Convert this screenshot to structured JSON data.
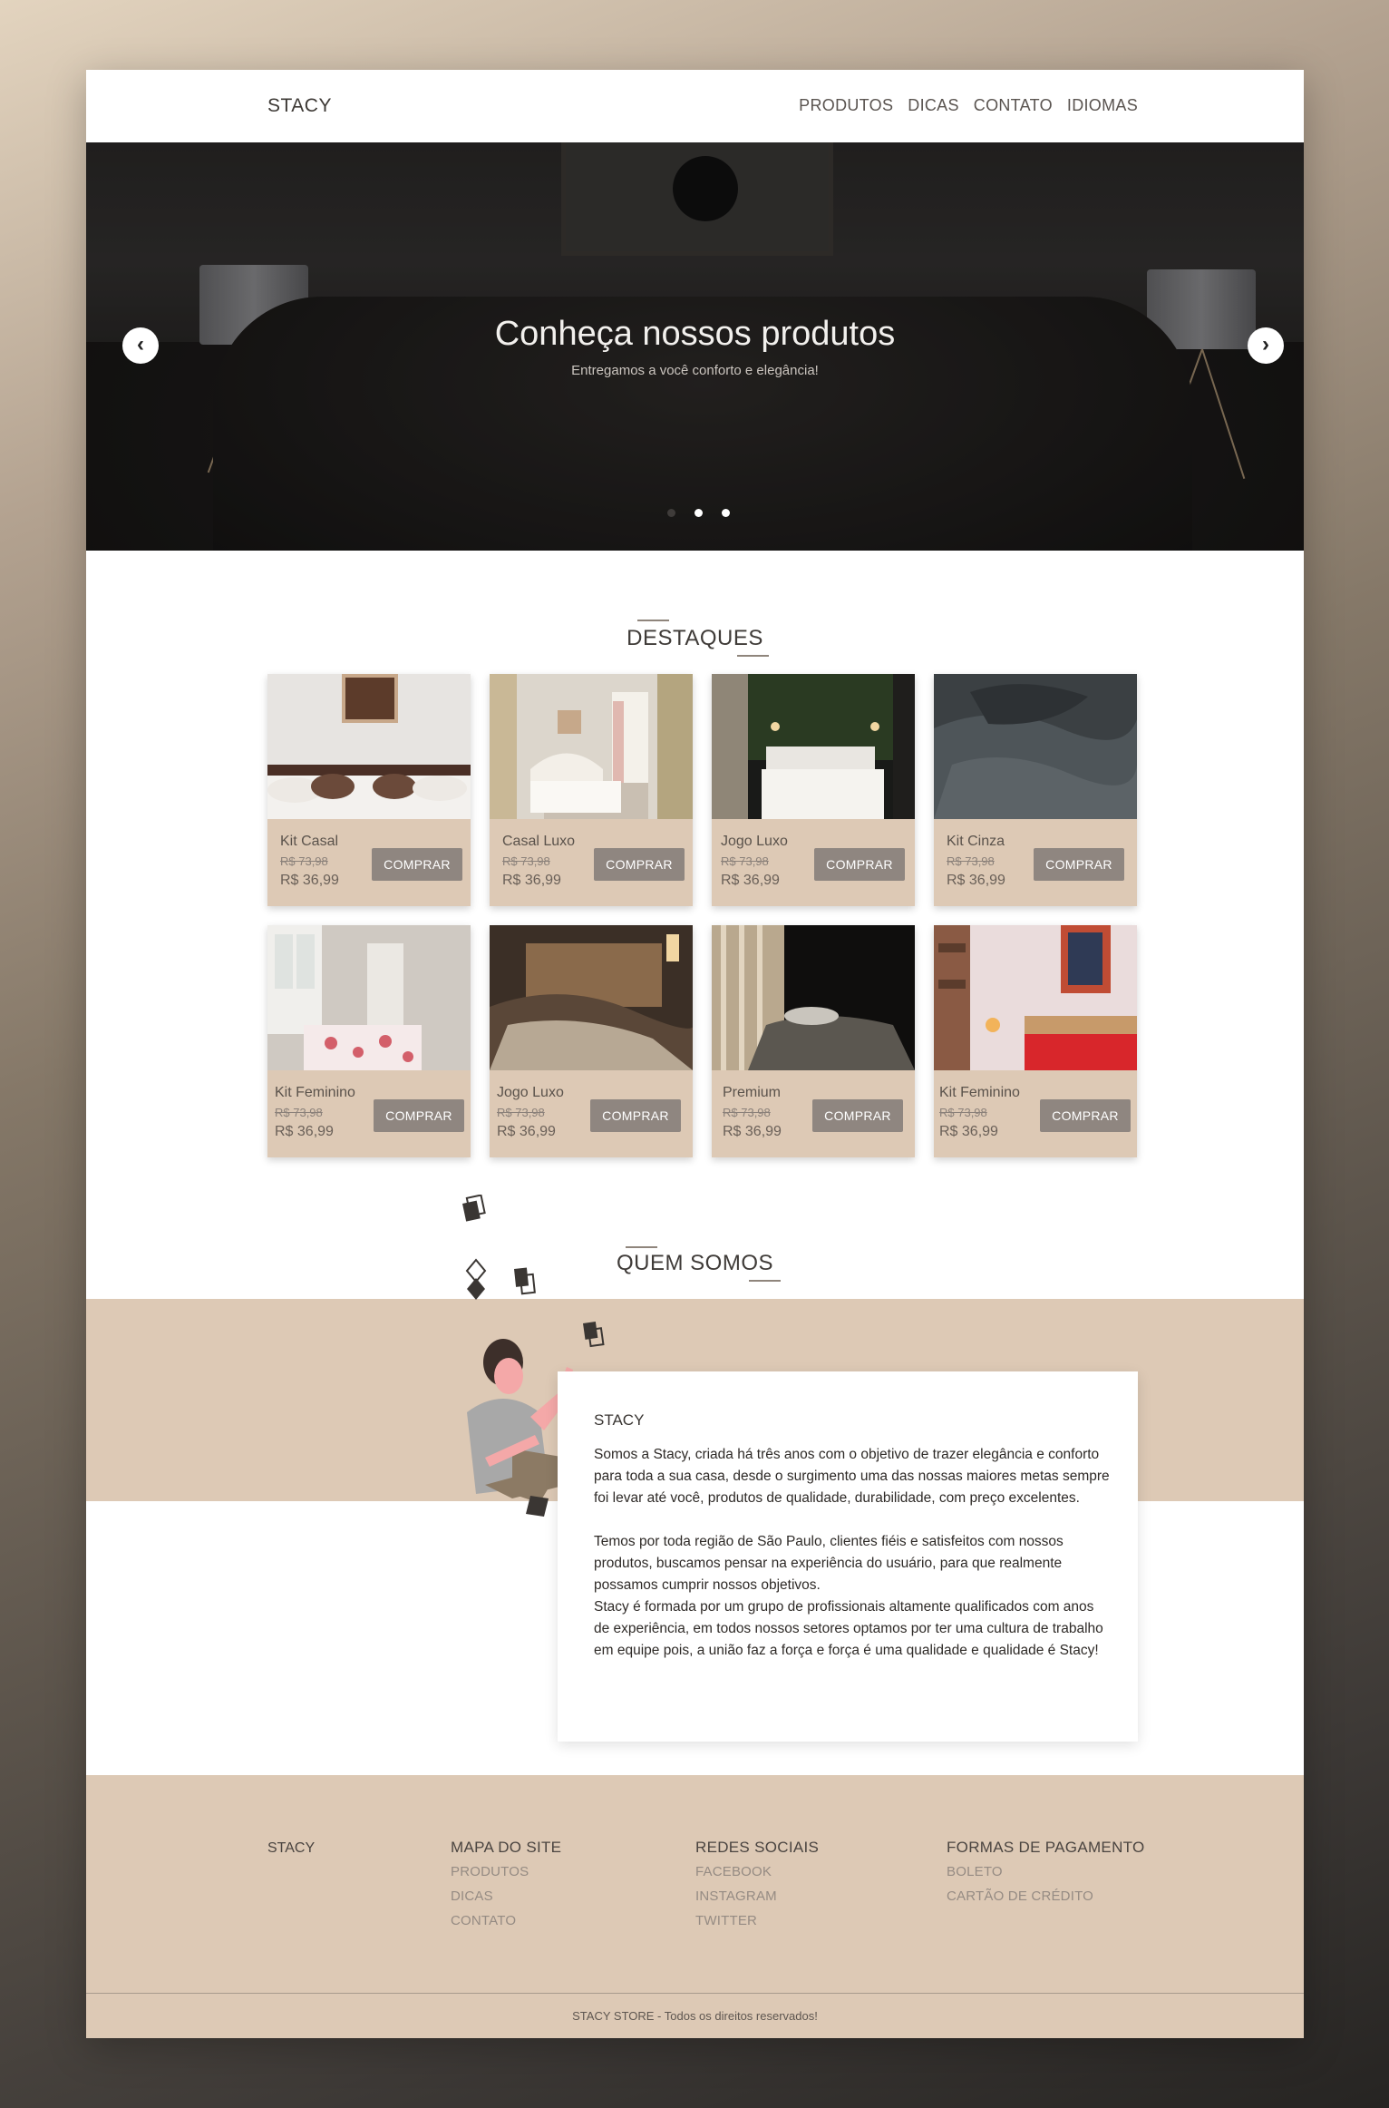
{
  "header": {
    "logo": "STACY",
    "nav": [
      "PRODUTOS",
      "DICAS",
      "CONTATO",
      "IDIOMAS"
    ]
  },
  "hero": {
    "title": "Conheça nossos produtos",
    "subtitle": "Entregamos a você conforto e elegância!",
    "prev_icon": "‹",
    "next_icon": "›",
    "slides_count": 3,
    "active_slide": 2
  },
  "featured": {
    "title": "DESTAQUES",
    "products": [
      {
        "name": "Kit Casal",
        "old_price": "R$ 73,98",
        "price": "R$ 36,99",
        "button": "COMPRAR"
      },
      {
        "name": "Casal Luxo",
        "old_price": "R$ 73,98",
        "price": "R$ 36,99",
        "button": "COMPRAR"
      },
      {
        "name": "Jogo Luxo",
        "old_price": "R$ 73,98",
        "price": "R$ 36,99",
        "button": "COMPRAR"
      },
      {
        "name": "Kit Cinza",
        "old_price": "R$ 73,98",
        "price": "R$ 36,99",
        "button": "COMPRAR"
      },
      {
        "name": "Kit Feminino",
        "old_price": "R$ 73,98",
        "price": "R$ 36,99",
        "button": "COMPRAR"
      },
      {
        "name": "Jogo Luxo",
        "old_price": "R$ 73,98",
        "price": "R$ 36,99",
        "button": "COMPRAR"
      },
      {
        "name": "Premium",
        "old_price": "R$ 73,98",
        "price": "R$ 36,99",
        "button": "COMPRAR"
      },
      {
        "name": "Kit Feminino",
        "old_price": "R$ 73,98",
        "price": "R$ 36,99",
        "button": "COMPRAR"
      }
    ]
  },
  "about": {
    "title": "QUEM SOMOS",
    "card_title": "STACY",
    "paragraph1": "Somos a Stacy, criada há três anos com o objetivo de trazer elegância e conforto para toda a sua casa, desde o surgimento uma das nossas maiores metas sempre foi levar até você, produtos de qualidade, durabilidade, com preço excelentes.",
    "paragraph2": "Temos por toda região de São Paulo, clientes fiéis e satisfeitos com nossos produtos, buscamos pensar na experiência do usuário, para que realmente possamos cumprir nossos objetivos.",
    "paragraph3": "Stacy é formada por um grupo de profissionais altamente qualificados com anos de experiência, em todos nossos setores optamos por ter uma cultura de trabalho em equipe pois, a união faz a força e força é uma qualidade e qualidade é Stacy!"
  },
  "footer": {
    "brand": "STACY",
    "sitemap": {
      "title": "MAPA DO SITE",
      "links": [
        "PRODUTOS",
        "DICAS",
        "CONTATO"
      ]
    },
    "social": {
      "title": "REDES SOCIAIS",
      "links": [
        "FACEBOOK",
        "INSTAGRAM",
        "TWITTER"
      ]
    },
    "payment": {
      "title": "FORMAS DE PAGAMENTO",
      "links": [
        "BOLETO",
        "CARTÃO DE CRÉDITO"
      ]
    },
    "copyright": "STACY STORE - Todos os direitos reservados!"
  },
  "colors": {
    "beige": "#ddc9b5",
    "button": "#8f8680",
    "text_dark": "#3a3633"
  }
}
